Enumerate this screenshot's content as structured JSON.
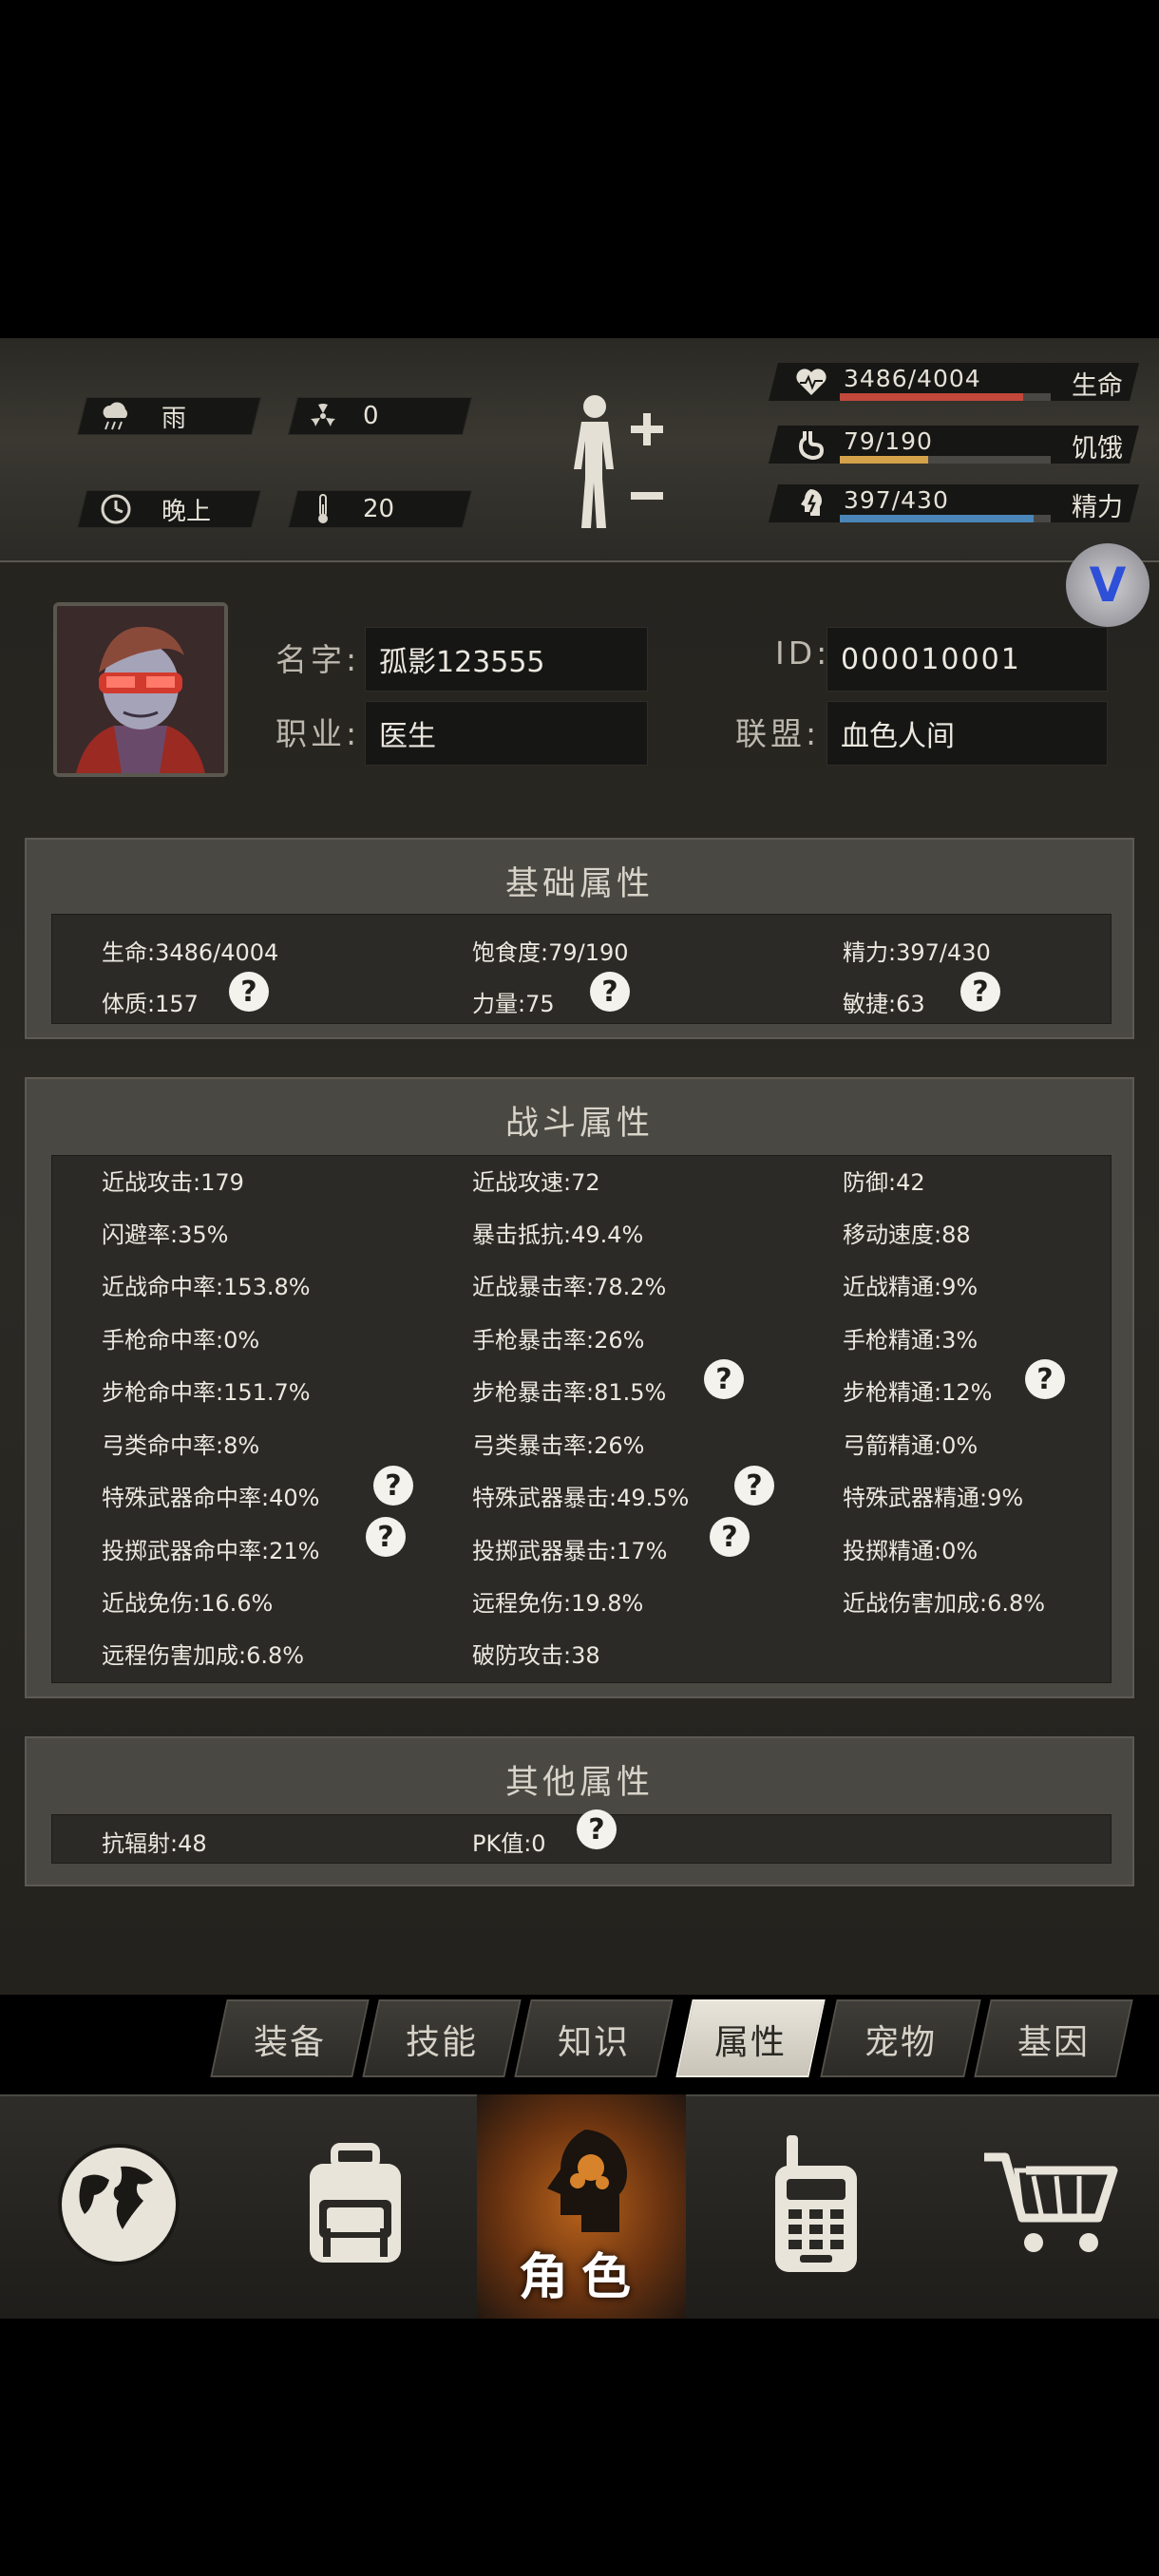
{
  "status": {
    "weather": "雨",
    "radiation": "0",
    "time_of_day": "晚上",
    "temperature": "20",
    "health": {
      "value": "3486/4004",
      "label": "生命",
      "fill": 0.87,
      "color": "#c2483b"
    },
    "hunger": {
      "value": "79/190",
      "label": "饥饿",
      "fill": 0.42,
      "color": "#d4a24a"
    },
    "energy": {
      "value": "397/430",
      "label": "精力",
      "fill": 0.92,
      "color": "#4a86b8"
    }
  },
  "profile": {
    "name_label": "名字:",
    "name": "孤影123555",
    "id_label": "ID:",
    "id": "000010001",
    "job_label": "职业:",
    "job": "医生",
    "alliance_label": "联盟:",
    "alliance": "血色人间"
  },
  "basic": {
    "title": "基础属性",
    "items": [
      "生命:3486/4004",
      "饱食度:79/190",
      "精力:397/430",
      "体质:157",
      "力量:75",
      "敏捷:63"
    ]
  },
  "combat": {
    "title": "战斗属性",
    "items": [
      "近战攻击:179",
      "近战攻速:72",
      "防御:42",
      "闪避率:35%",
      "暴击抵抗:49.4%",
      "移动速度:88",
      "近战命中率:153.8%",
      "近战暴击率:78.2%",
      "近战精通:9%",
      "手枪命中率:0%",
      "手枪暴击率:26%",
      "手枪精通:3%",
      "步枪命中率:151.7%",
      "步枪暴击率:81.5%",
      "步枪精通:12%",
      "弓类命中率:8%",
      "弓类暴击率:26%",
      "弓箭精通:0%",
      "特殊武器命中率:40%",
      "特殊武器暴击:49.5%",
      "特殊武器精通:9%",
      "投掷武器命中率:21%",
      "投掷武器暴击:17%",
      "投掷精通:0%",
      "近战免伤:16.6%",
      "远程免伤:19.8%",
      "近战伤害加成:6.8%",
      "远程伤害加成:6.8%",
      "破防攻击:38"
    ]
  },
  "other": {
    "title": "其他属性",
    "items": [
      "抗辐射:48",
      "PK值:0"
    ]
  },
  "help_glyph": "?",
  "tabs": [
    "装备",
    "技能",
    "知识",
    "属性",
    "宠物",
    "基因"
  ],
  "active_tab": "属性",
  "nav": {
    "active_label": "角色"
  },
  "icons": [
    "rain-cloud-icon",
    "radiation-icon",
    "clock-icon",
    "thermometer-icon",
    "body-figure-icon",
    "heart-icon",
    "stomach-icon",
    "brain-icon",
    "globe-icon",
    "backpack-icon",
    "character-head-icon",
    "walkie-talkie-icon",
    "cart-icon",
    "help-icon"
  ],
  "overlay_badge": "V"
}
